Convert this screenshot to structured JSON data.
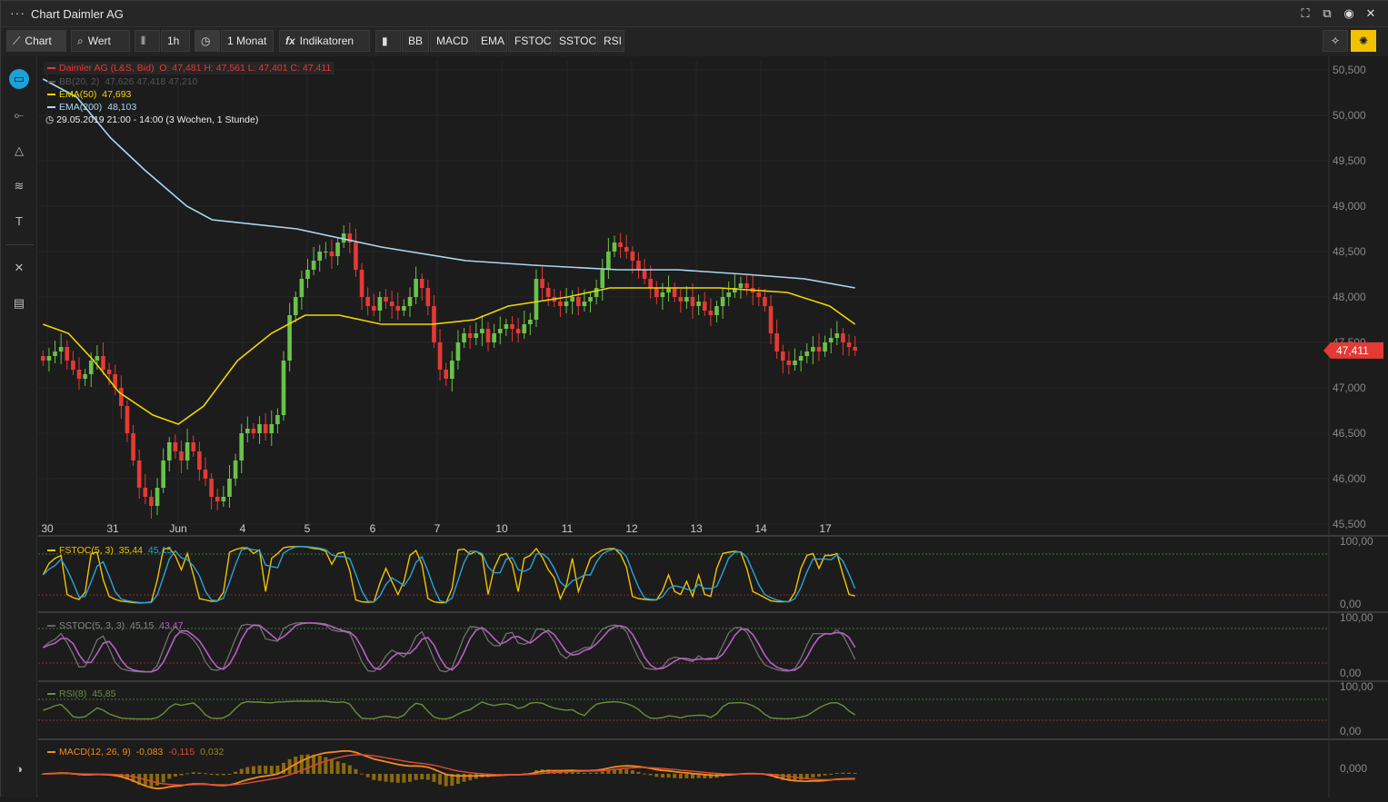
{
  "window": {
    "title": "Chart Daimler AG",
    "menu_icon": "more-dots-icon",
    "buttons": [
      "fullscreen-icon",
      "popout-icon",
      "record-icon",
      "close-icon"
    ]
  },
  "toolbar": {
    "chart_label": "Chart",
    "value_label": "Wert",
    "interval_label": "1h",
    "period_label": "1 Monat",
    "indicators_label": "Indikatoren",
    "quick_indicators": [
      "BB",
      "MACD",
      "EMA",
      "FSTOC",
      "SSTOC",
      "RSI"
    ]
  },
  "sidebar": {
    "tools": [
      "price-tag-icon",
      "line-tool-icon",
      "triangle-tool-icon",
      "fibonacci-icon",
      "text-tool-icon",
      "tools-icon",
      "calculator-icon"
    ],
    "bottom": "contrast-icon"
  },
  "legend": {
    "instrument": "Daimler AG (L&S, Bid)",
    "ohlc": "O: 47,481  H: 47,561  L: 47,401  C: 47,411",
    "bb": {
      "label": "BB(20, 2)",
      "values": "47,626   47,418   47,210"
    },
    "ema50": {
      "label": "EMA(50)",
      "value": "47,693"
    },
    "ema200": {
      "label": "EMA(200)",
      "value": "48,103"
    },
    "range": "29.05.2019 21:00 - 14:00   (3 Wochen, 1 Stunde)"
  },
  "colors": {
    "up": "#69c24a",
    "down": "#e53935",
    "ema50": "#f2d600",
    "ema200": "#a9d8f0",
    "fstoc": "#f2c200",
    "fstoc_signal": "#2aa3d6",
    "sstoc": "#b660c2",
    "rsi": "#6a8f3a",
    "macd": "#f28a1e",
    "macd_signal": "#e04a3a",
    "accent": "#f2c200"
  },
  "chart_data": {
    "type": "candlestick",
    "title": "Chart Daimler AG",
    "x_tick_labels": [
      "30",
      "31",
      "Jun",
      "4",
      "5",
      "6",
      "7",
      "10",
      "11",
      "12",
      "13",
      "14",
      "17"
    ],
    "y_tick_labels": [
      "50,500",
      "50,000",
      "49,500",
      "49,000",
      "48,500",
      "48,000",
      "47,500",
      "47,000",
      "46,500",
      "46,000",
      "45,500"
    ],
    "ylim": [
      45.4,
      50.6
    ],
    "last_price_label": "47,411",
    "ema50_anchor": [
      [
        0,
        47.7
      ],
      [
        6,
        47.6
      ],
      [
        12,
        47.3
      ],
      [
        18,
        46.95
      ],
      [
        26,
        46.7
      ],
      [
        32,
        46.6
      ],
      [
        38,
        46.8
      ],
      [
        46,
        47.3
      ],
      [
        54,
        47.6
      ],
      [
        62,
        47.8
      ],
      [
        70,
        47.8
      ],
      [
        80,
        47.7
      ],
      [
        92,
        47.7
      ],
      [
        102,
        47.75
      ],
      [
        110,
        47.9
      ],
      [
        124,
        48.0
      ],
      [
        134,
        48.1
      ],
      [
        148,
        48.1
      ],
      [
        160,
        48.1
      ],
      [
        176,
        48.05
      ],
      [
        186,
        47.9
      ],
      [
        192,
        47.7
      ]
    ],
    "ema200_anchor": [
      [
        0,
        50.4
      ],
      [
        8,
        50.2
      ],
      [
        16,
        49.75
      ],
      [
        24,
        49.4
      ],
      [
        34,
        49.0
      ],
      [
        40,
        48.85
      ],
      [
        60,
        48.75
      ],
      [
        80,
        48.55
      ],
      [
        100,
        48.4
      ],
      [
        116,
        48.35
      ],
      [
        136,
        48.3
      ],
      [
        150,
        48.3
      ],
      [
        166,
        48.25
      ],
      [
        180,
        48.2
      ],
      [
        192,
        48.1
      ]
    ],
    "ohlc_closes": [
      47.3,
      47.35,
      47.4,
      47.45,
      47.3,
      47.2,
      47.1,
      47.15,
      47.3,
      47.35,
      47.2,
      47.15,
      47.0,
      46.8,
      46.5,
      46.2,
      45.9,
      45.8,
      45.7,
      45.9,
      46.2,
      46.4,
      46.3,
      46.2,
      46.4,
      46.3,
      46.1,
      46.0,
      45.8,
      45.75,
      45.8,
      46.0,
      46.2,
      46.5,
      46.55,
      46.5,
      46.6,
      46.5,
      46.6,
      46.7,
      47.3,
      47.8,
      48.0,
      48.2,
      48.3,
      48.4,
      48.5,
      48.5,
      48.45,
      48.6,
      48.7,
      48.6,
      48.3,
      48.0,
      47.9,
      47.85,
      48.0,
      47.95,
      47.9,
      47.85,
      47.9,
      48.0,
      48.2,
      48.1,
      47.9,
      47.5,
      47.2,
      47.1,
      47.3,
      47.5,
      47.6,
      47.55,
      47.6,
      47.65,
      47.5,
      47.6,
      47.65,
      47.7,
      47.65,
      47.6,
      47.7,
      47.75,
      48.2,
      48.1,
      48.0,
      47.95,
      47.9,
      47.95,
      48.0,
      47.9,
      47.95,
      48.0,
      48.1,
      48.3,
      48.5,
      48.6,
      48.55,
      48.5,
      48.4,
      48.3,
      48.2,
      48.1,
      48.0,
      48.05,
      48.1,
      48.0,
      47.95,
      48.0,
      47.9,
      47.95,
      47.85,
      47.8,
      47.9,
      48.0,
      48.05,
      48.1,
      48.15,
      48.1,
      48.05,
      48.0,
      47.9,
      47.6,
      47.4,
      47.3,
      47.25,
      47.3,
      47.35,
      47.4,
      47.45,
      47.4,
      47.5,
      47.55,
      47.6,
      47.5,
      47.45,
      47.41
    ],
    "panels": [
      {
        "name": "FSTOC",
        "label": "FSTOC(5, 3)",
        "values": [
          "35,44",
          "45,15"
        ],
        "ylabels": [
          "100,00",
          "0,00"
        ]
      },
      {
        "name": "SSTOC",
        "label": "SSTOC(5, 3, 3)",
        "values": [
          "45,15",
          "43,47"
        ],
        "ylabels": [
          "100,00",
          "0,00"
        ]
      },
      {
        "name": "RSI",
        "label": "RSI(8)",
        "values": [
          "45,85"
        ],
        "ylabels": [
          "100,00",
          "0,00"
        ]
      },
      {
        "name": "MACD",
        "label": "MACD(12, 26, 9)",
        "values": [
          "-0,083",
          "-0,115",
          "0,032"
        ],
        "ylabels": [
          "0,000"
        ]
      }
    ]
  }
}
